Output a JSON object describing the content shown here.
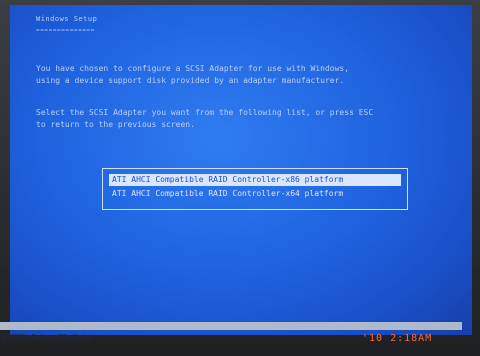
{
  "setup": {
    "title": "Windows Setup",
    "title_underline": "==============",
    "paragraph1": "You have chosen to configure a SCSI Adapter for use with Windows,\nusing a device support disk provided by an adapter manufacturer.",
    "paragraph2": "Select the SCSI Adapter you want from the following list, or press ESC\nto return to the previous screen.",
    "options": [
      {
        "label": "ATI AHCI Compatible RAID Controller-x86 platform",
        "selected": true
      },
      {
        "label": "ATI AHCI Compatible RAID Controller-x64 platform",
        "selected": false
      }
    ]
  },
  "statusbar": {
    "items": [
      "ENTER=Select",
      "F3=Exit"
    ]
  },
  "camera_timestamp": "'10  2:18AM",
  "colors": {
    "screen_blue": "#1f63df",
    "selected_bg": "#d9e6ff",
    "timestamp_orange": "#ff6a3a"
  }
}
